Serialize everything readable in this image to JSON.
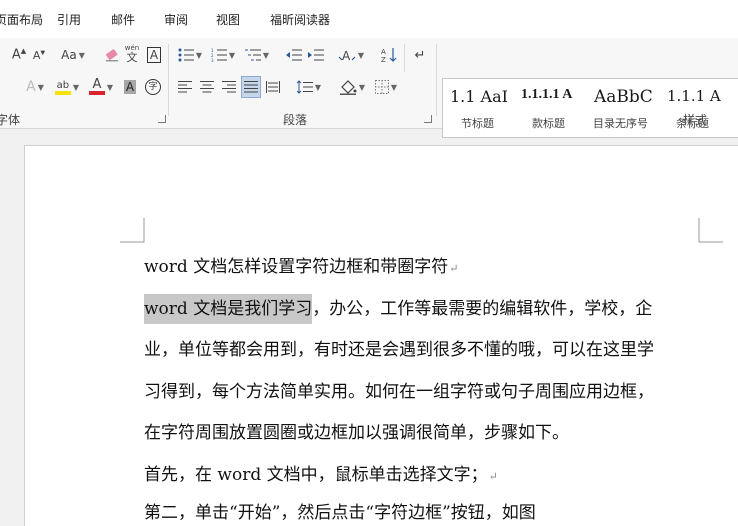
{
  "tabs": [
    "页面布局",
    "引用",
    "邮件",
    "审阅",
    "视图",
    "福昕阅读器"
  ],
  "ribbon": {
    "font_group_label": "字体",
    "paragraph_group_label": "段落",
    "styles_group_label": "样式",
    "change_case_label": "Aa",
    "phonetic_top": "wén",
    "phonetic_bottom": "文",
    "enclosed_char": "字",
    "char_border_char": "A",
    "char_shading_char": "A",
    "colors": {
      "highlight": "#f4e20a",
      "font_color": "#d9232e",
      "accent": "#2b579a"
    }
  },
  "styles_gallery": [
    {
      "preview": "1.1  AaI",
      "name": "节标题"
    },
    {
      "preview": "1.1.1.1 A",
      "name": "款标题"
    },
    {
      "preview": "AaBbC",
      "name": "目录无序号"
    },
    {
      "preview": "1.1.1  A",
      "name": "条标题"
    }
  ],
  "document": {
    "lines": [
      {
        "text": "word 文档怎样设置字符边框和带圈字符"
      },
      {
        "highlight": "word  文档是我们学习",
        "text": "，办公，工作等最需要的编辑软件，学校，企"
      },
      {
        "text": "业，单位等都会用到，有时还是会遇到很多不懂的哦，可以在这里学"
      },
      {
        "text": "习得到，每个方法简单实用。如何在一组字符或句子周围应用边框，"
      },
      {
        "text": "在字符周围放置圆圈或边框加以强调很简单，步骤如下。"
      },
      {
        "text": "首先，在 word 文档中，鼠标单击选择文字；"
      },
      {
        "text": "第二，单击“开始”，然后点击“字符边框”按钮，如图"
      }
    ],
    "paragraph_mark": "↵"
  }
}
